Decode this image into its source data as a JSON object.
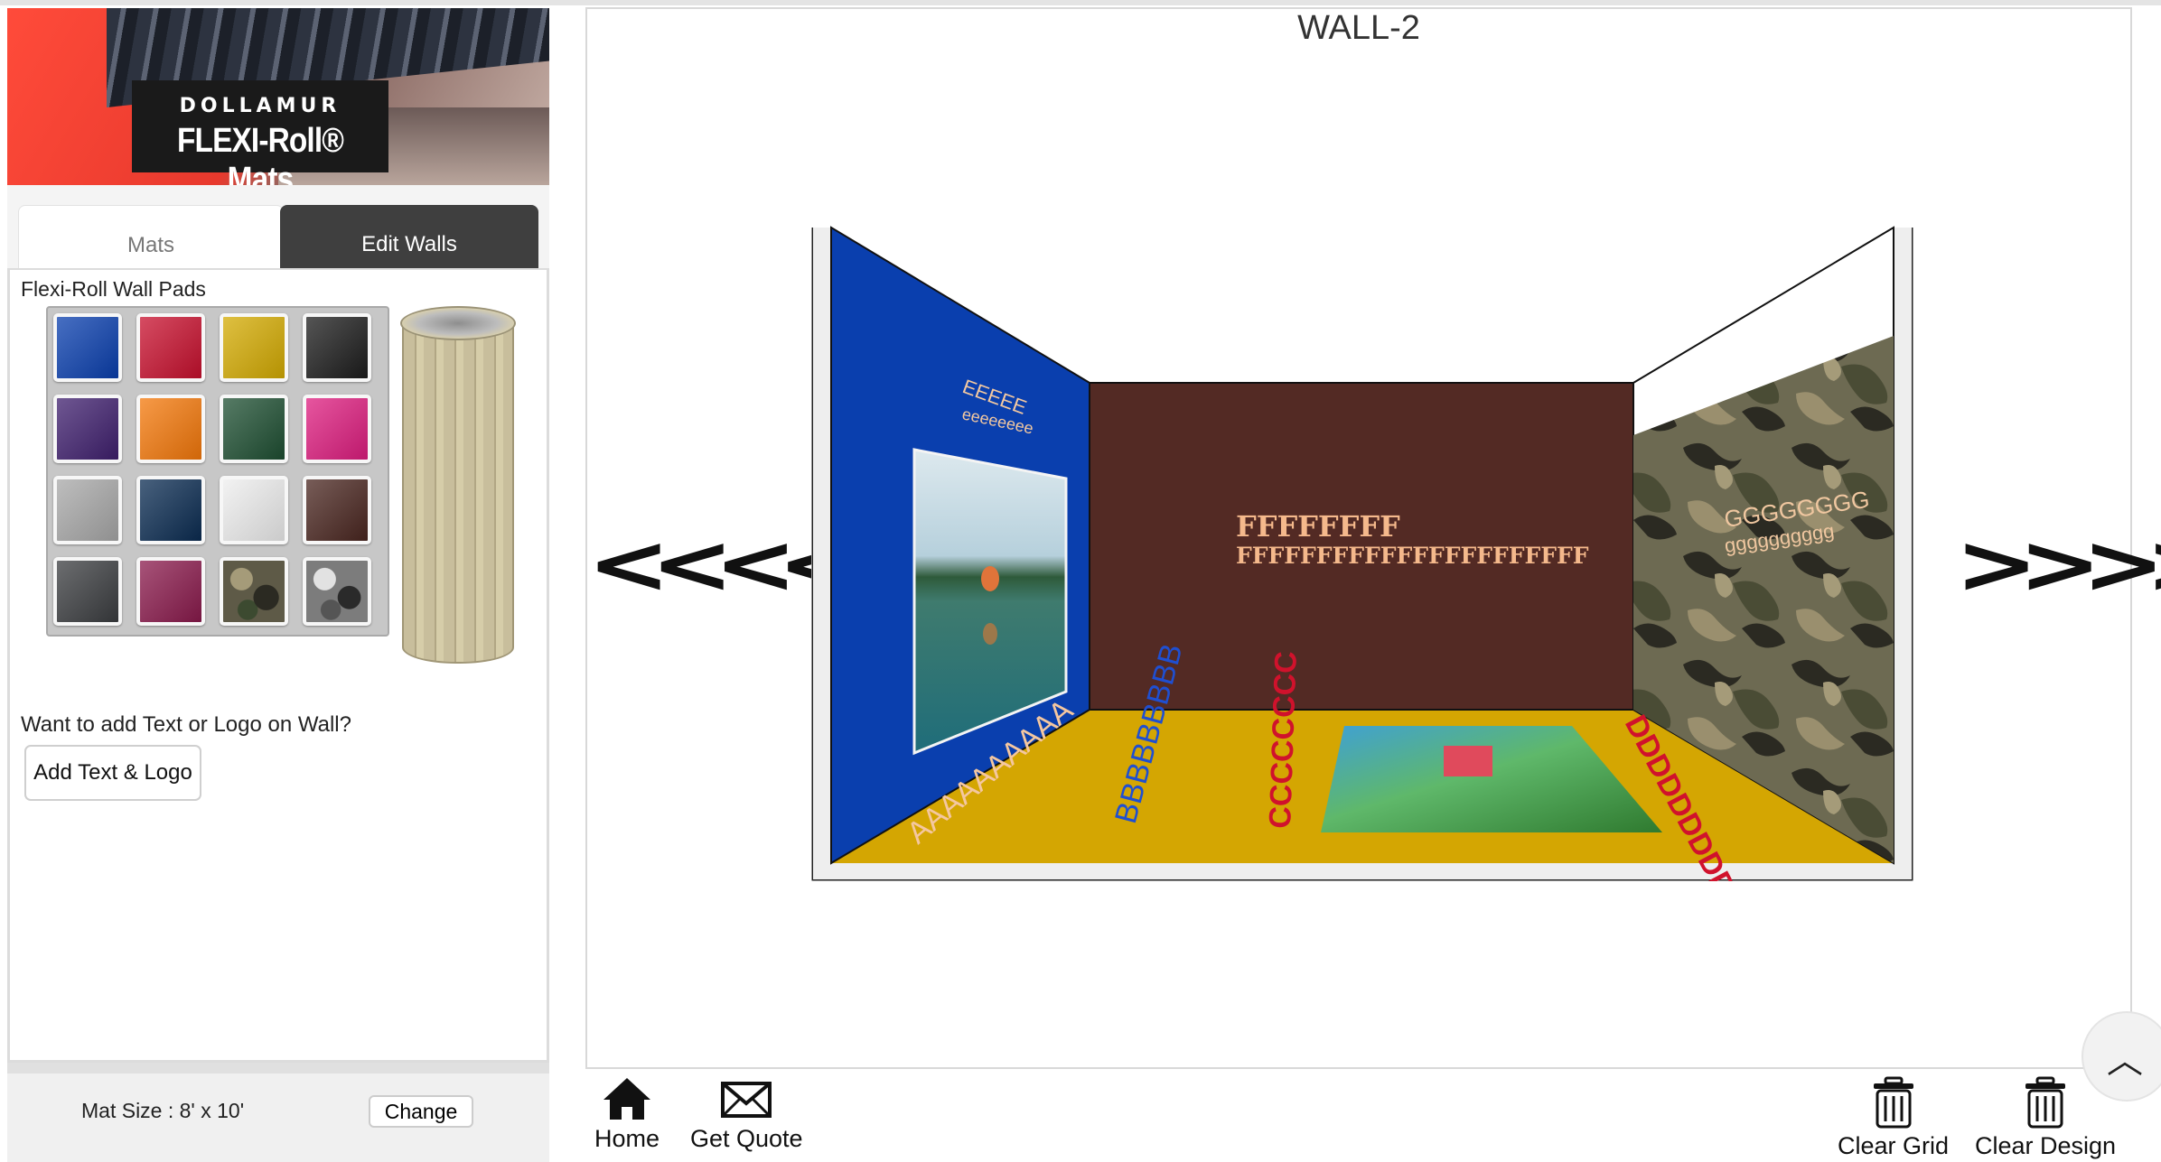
{
  "brand": {
    "logo_brand": "DOLLAMUR",
    "logo_title": "FLEXI-Roll® Mats"
  },
  "tabs": [
    {
      "label": "Mats",
      "active": false
    },
    {
      "label": "Edit Walls",
      "active": true
    }
  ],
  "wall_pads": {
    "title": "Flexi-Roll Wall Pads",
    "swatches": [
      {
        "name": "royal-blue",
        "color": "#0a3fae"
      },
      {
        "name": "red",
        "color": "#c8102e"
      },
      {
        "name": "gold",
        "color": "#d4ab02"
      },
      {
        "name": "black",
        "color": "#1c1c1c"
      },
      {
        "name": "purple",
        "color": "#3f1f6e"
      },
      {
        "name": "orange",
        "color": "#f4780a"
      },
      {
        "name": "dark-green",
        "color": "#1e4f32"
      },
      {
        "name": "pink",
        "color": "#de1d7f"
      },
      {
        "name": "silver",
        "color": "#a8a8a8"
      },
      {
        "name": "navy",
        "color": "#0b2c52"
      },
      {
        "name": "white",
        "color": "#eeeeee"
      },
      {
        "name": "brown",
        "color": "#4a2620"
      },
      {
        "name": "charcoal",
        "color": "#3b3d40"
      },
      {
        "name": "maroon",
        "color": "#8a1a4c"
      },
      {
        "name": "woodland-camo",
        "color": "#5e5a47"
      },
      {
        "name": "urban-camo",
        "color": "#7c7c7c"
      }
    ]
  },
  "text_logo": {
    "prompt": "Want to add Text or Logo on Wall?",
    "button_label": "Add Text & Logo"
  },
  "mat_size": {
    "label": "Mat Size  : 8' x 10'",
    "change_label": "Change"
  },
  "viewer": {
    "title": "WALL-2",
    "prev_arrows": "<<<<",
    "next_arrows": ">>>>",
    "left_wall": {
      "color": "#0a3fae",
      "text_lines": [
        "EEEEE",
        "eeeeeeee"
      ]
    },
    "back_wall": {
      "color": "#532a24",
      "text_lines": [
        "FFFFFFFF",
        "FFFFFFFFFFFFFFFFFFFFFF"
      ]
    },
    "right_wall": {
      "color": "#58543f",
      "text_lines": [
        "GGGGGGGG",
        "gggggggggg"
      ]
    },
    "floor": {
      "color": "#d4a602",
      "labels": [
        "AAAAAAAAAA",
        "BBBBBBBBB",
        "CCCCCCCC",
        "DDDDDDDDDD"
      ]
    }
  },
  "toolbar": {
    "home_label": "Home",
    "quote_label": "Get Quote",
    "clear_grid_label": "Clear Grid",
    "clear_design_label": "Clear Design"
  }
}
